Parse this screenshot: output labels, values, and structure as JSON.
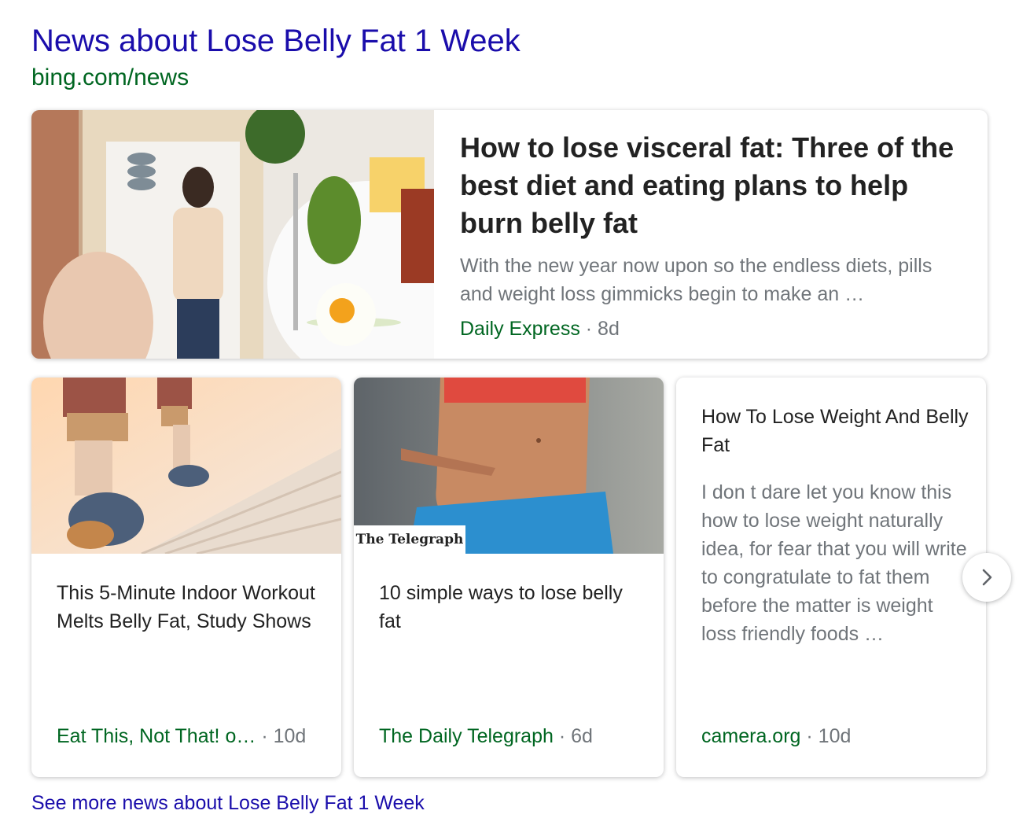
{
  "header": {
    "title": "News about Lose Belly Fat 1 Week",
    "source_url": "bing.com/news"
  },
  "featured": {
    "headline": "How to lose visceral fat: Three of the best diet and eating plans to help burn belly fat",
    "snippet": "With the new year now upon so the endless diets, pills and weight loss gimmicks begin to make an …",
    "source": "Daily Express",
    "age": "· 8d"
  },
  "cards": [
    {
      "headline": "This 5-Minute Indoor Workout Melts Belly Fat, Study Shows",
      "source": "Eat This, Not That! o…",
      "age": "· 10d"
    },
    {
      "headline": "10 simple ways to lose belly fat",
      "badge": "The Telegraph",
      "source": "The Daily Telegraph",
      "age": "· 6d"
    },
    {
      "headline": "How To Lose Weight And Belly Fat",
      "snippet": "I don t dare let you know this how to lose weight naturally idea, for fear that you will write to congratulate to fat them before the matter is weight loss friendly foods …",
      "source": "camera.org",
      "age": "· 10d"
    }
  ],
  "footer": {
    "see_more": "See more news about Lose Belly Fat 1 Week"
  },
  "icons": {
    "next": "chevron-right-icon"
  },
  "colors": {
    "link": "#1a0dab",
    "source_green": "#006621",
    "meta_gray": "#70757a"
  }
}
